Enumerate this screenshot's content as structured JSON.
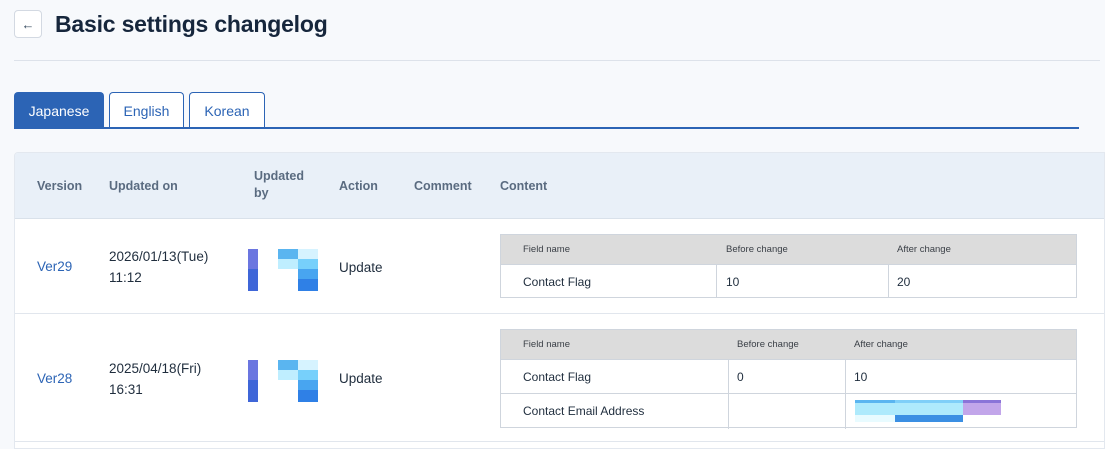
{
  "header": {
    "back_icon": "arrow-left-icon",
    "back_glyph": "←",
    "title": "Basic settings changelog"
  },
  "tabs": [
    {
      "label": "Japanese",
      "active": true
    },
    {
      "label": "English",
      "active": false
    },
    {
      "label": "Korean",
      "active": false
    }
  ],
  "table": {
    "columns": {
      "version": "Version",
      "updated_on": "Updated on",
      "updated_by": "Updated by",
      "action": "Action",
      "comment": "Comment",
      "content": "Content"
    },
    "rows": [
      {
        "version": "Ver29",
        "date": "2026/01/13(Tue)",
        "time": "11:12",
        "action": "Update",
        "comment": "",
        "changes": {
          "headers": {
            "field": "Field name",
            "before": "Before change",
            "after": "After change"
          },
          "items": [
            {
              "field": "Contact Flag",
              "before": "10",
              "after": "20"
            }
          ]
        }
      },
      {
        "version": "Ver28",
        "date": "2025/04/18(Fri)",
        "time": "16:31",
        "action": "Update",
        "comment": "",
        "changes": {
          "headers": {
            "field": "Field name",
            "before": "Before change",
            "after": "After change"
          },
          "items": [
            {
              "field": "Contact Flag",
              "before": "0",
              "after": "10"
            },
            {
              "field": "Contact Email Address",
              "before": "",
              "after": ""
            }
          ]
        }
      }
    ]
  },
  "colors": {
    "accent": "#2c64b5",
    "header_bg": "#e9f0f8",
    "inner_header_bg": "#dcdcdc"
  }
}
